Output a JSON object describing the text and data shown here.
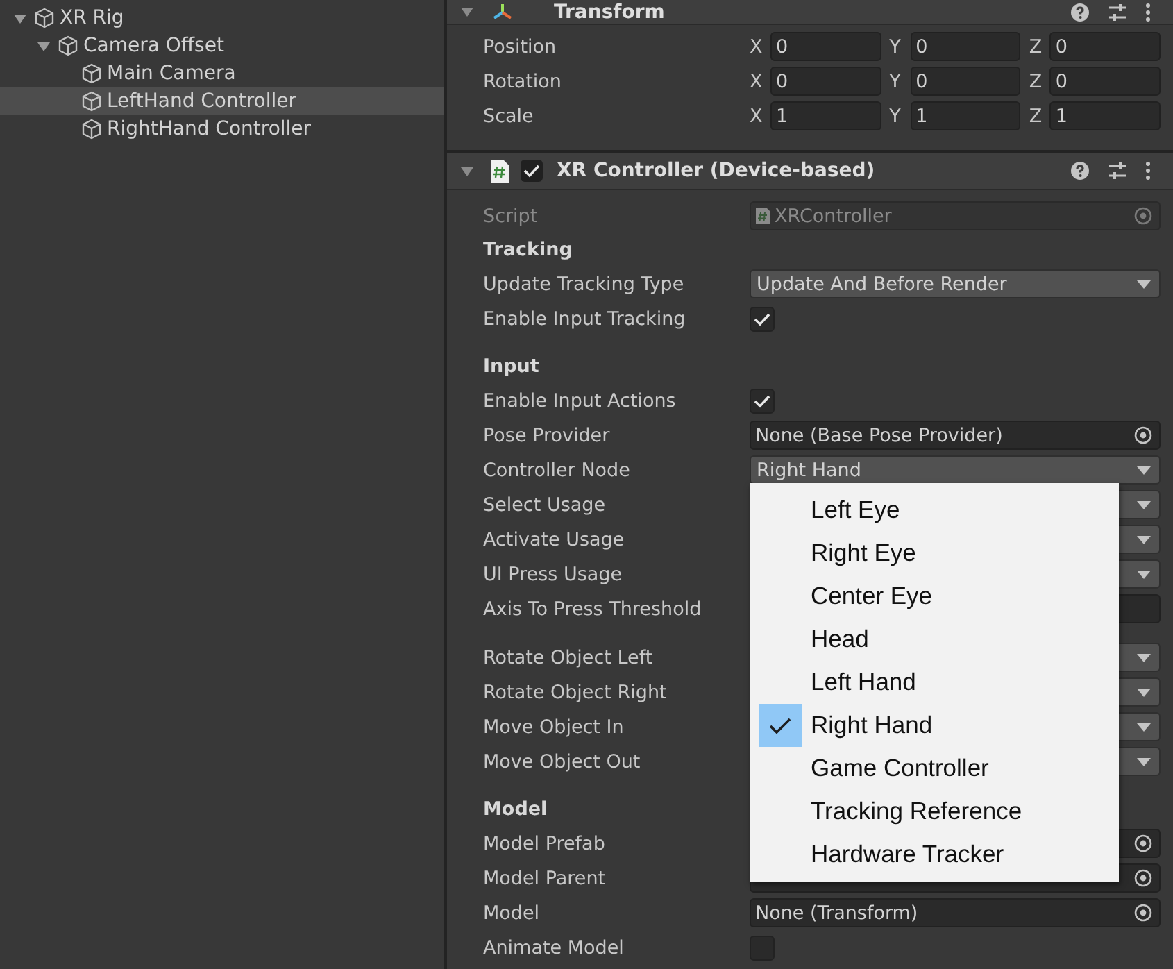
{
  "hierarchy": [
    {
      "label": "XR Rig",
      "expanded": true,
      "selected": false,
      "children": [
        {
          "label": "Camera Offset",
          "expanded": true,
          "selected": false,
          "children": [
            {
              "label": "Main Camera",
              "selected": false
            },
            {
              "label": "LeftHand Controller",
              "selected": true
            },
            {
              "label": "RightHand Controller",
              "selected": false
            }
          ]
        }
      ]
    }
  ],
  "transform": {
    "title": "Transform",
    "expanded": true,
    "rows": [
      {
        "label": "Position",
        "fields": [
          {
            "axis": "X",
            "value": "0"
          },
          {
            "axis": "Y",
            "value": "0"
          },
          {
            "axis": "Z",
            "value": "0"
          }
        ]
      },
      {
        "label": "Rotation",
        "fields": [
          {
            "axis": "X",
            "value": "0"
          },
          {
            "axis": "Y",
            "value": "0"
          },
          {
            "axis": "Z",
            "value": "0"
          }
        ]
      },
      {
        "label": "Scale",
        "fields": [
          {
            "axis": "X",
            "value": "1"
          },
          {
            "axis": "Y",
            "value": "1"
          },
          {
            "axis": "Z",
            "value": "1"
          }
        ]
      }
    ]
  },
  "controller": {
    "title": "XR Controller (Device-based)",
    "expanded": true,
    "enabled": true,
    "groups": [
      {
        "rows": [
          {
            "kind": "object",
            "label": "Script",
            "value": "XRController",
            "disabled": true
          },
          {
            "kind": "header",
            "label": "Tracking"
          },
          {
            "kind": "dropdown",
            "label": "Update Tracking Type",
            "value": "Update And Before Render"
          },
          {
            "kind": "checkbox",
            "label": "Enable Input Tracking",
            "checked": true
          }
        ]
      },
      {
        "rows": [
          {
            "kind": "header",
            "label": "Input"
          },
          {
            "kind": "checkbox",
            "label": "Enable Input Actions",
            "checked": true
          },
          {
            "kind": "object",
            "label": "Pose Provider",
            "value": "None (Base Pose Provider)",
            "disabled": false
          },
          {
            "kind": "dropdown",
            "label": "Controller Node",
            "value": "Right Hand"
          },
          {
            "kind": "dropdown",
            "label": "Select Usage"
          },
          {
            "kind": "dropdown",
            "label": "Activate Usage"
          },
          {
            "kind": "dropdown",
            "label": "UI Press Usage"
          },
          {
            "kind": "float",
            "label": "Axis To Press Threshold"
          }
        ]
      },
      {
        "rows": [
          {
            "kind": "dropdown",
            "label": "Rotate Object Left"
          },
          {
            "kind": "dropdown",
            "label": "Rotate Object Right"
          },
          {
            "kind": "dropdown",
            "label": "Move Object In"
          },
          {
            "kind": "dropdown",
            "label": "Move Object Out"
          }
        ]
      },
      {
        "rows": [
          {
            "kind": "header",
            "label": "Model"
          },
          {
            "kind": "object",
            "label": "Model Prefab",
            "disabled": false
          },
          {
            "kind": "object",
            "label": "Model Parent",
            "disabled": false
          },
          {
            "kind": "object",
            "label": "Model",
            "value": "None (Transform)",
            "disabled": false
          },
          {
            "kind": "checkbox",
            "label": "Animate Model",
            "checked": false
          }
        ]
      }
    ]
  },
  "node_menu": {
    "options": [
      {
        "label": "Left Eye",
        "selected": false
      },
      {
        "label": "Right Eye",
        "selected": false
      },
      {
        "label": "Center Eye",
        "selected": false
      },
      {
        "label": "Head",
        "selected": false
      },
      {
        "label": "Left Hand",
        "selected": false
      },
      {
        "label": "Right Hand",
        "selected": true
      },
      {
        "label": "Game Controller",
        "selected": false
      },
      {
        "label": "Tracking Reference",
        "selected": false
      },
      {
        "label": "Hardware Tracker",
        "selected": false
      }
    ]
  }
}
